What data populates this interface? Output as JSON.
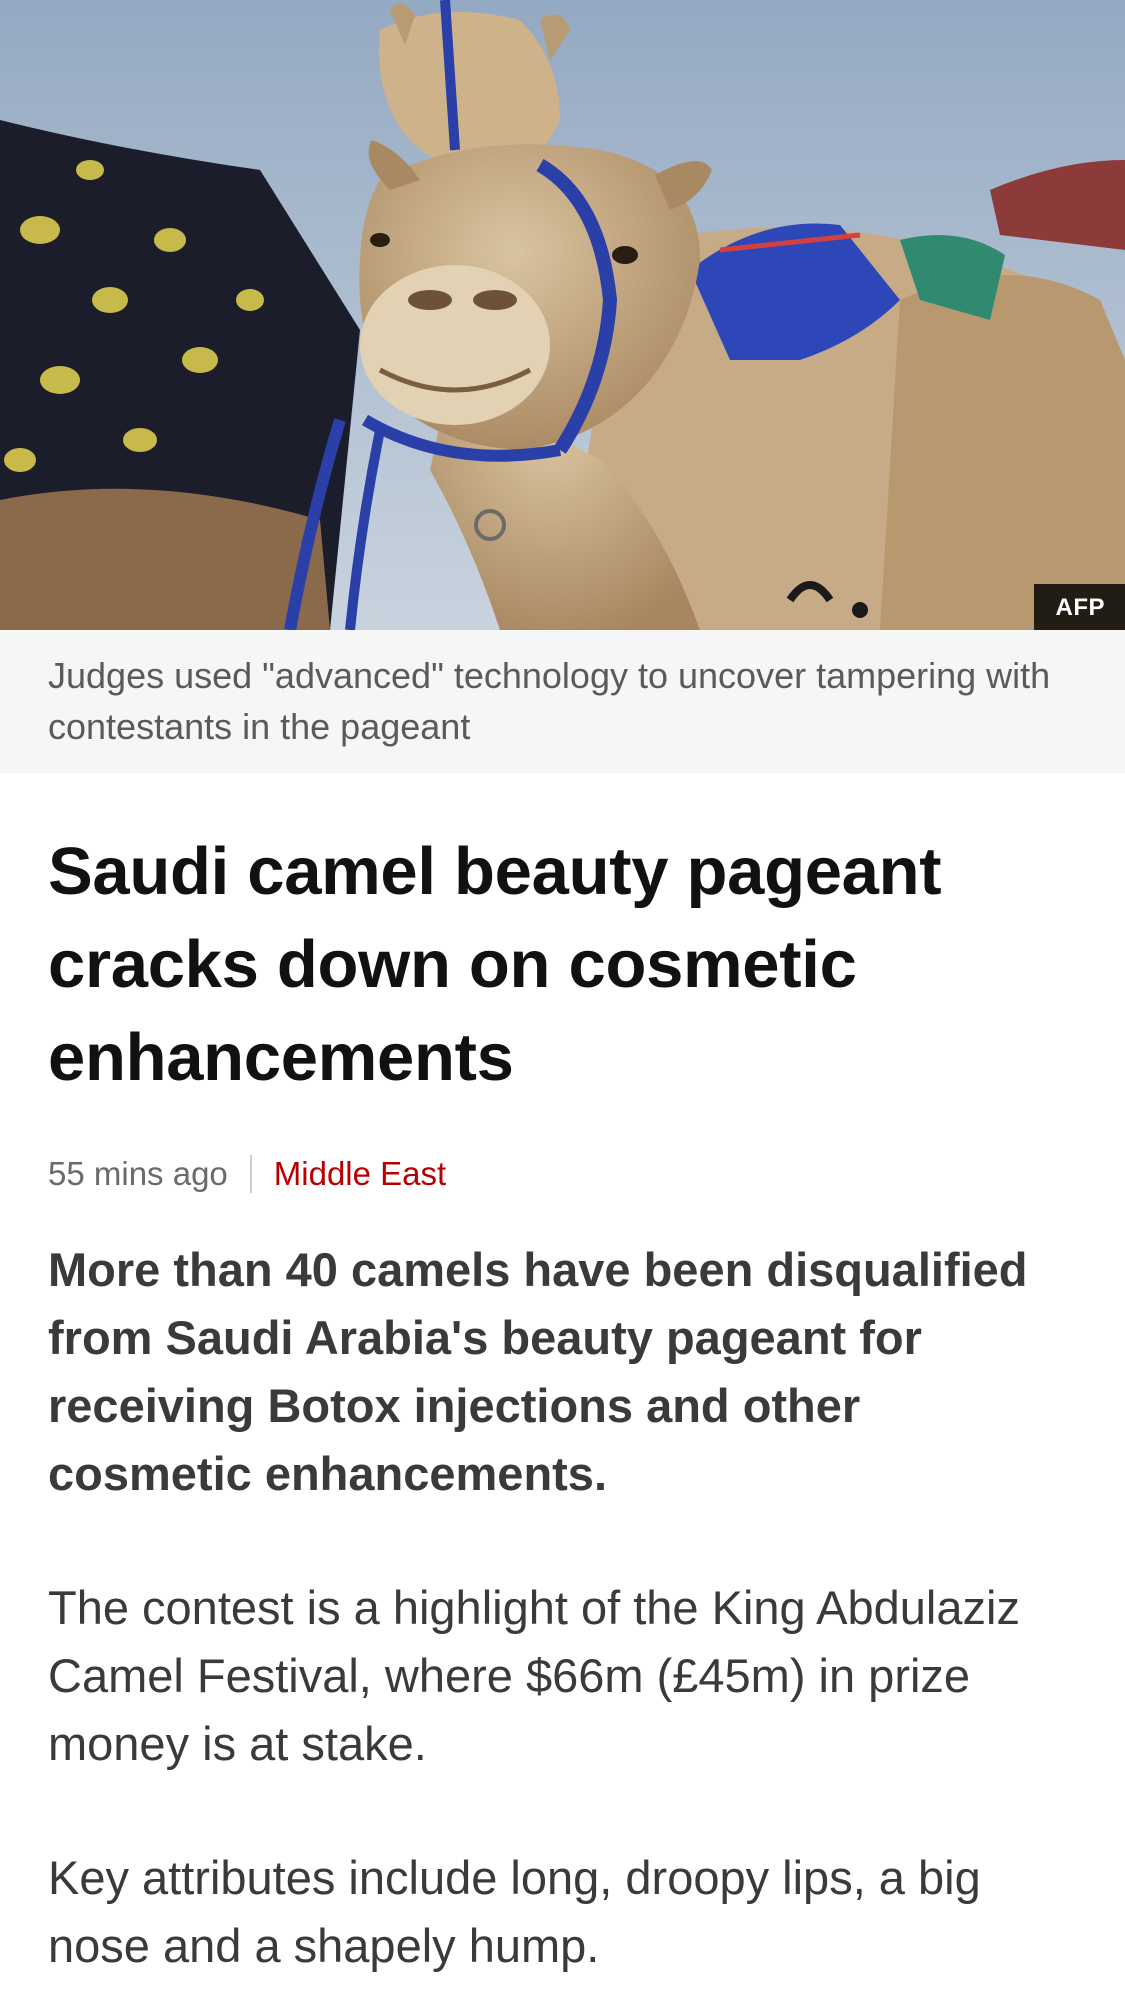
{
  "hero": {
    "image_alt": "Camels wearing blue halters and colourful saddle cloths",
    "credit": "AFP"
  },
  "caption": "Judges used \"advanced\" technology to uncover tampering with contestants in the pageant",
  "headline": "Saudi camel beauty pageant cracks down on cosmetic enhancements",
  "meta": {
    "time": "55 mins ago",
    "section": "Middle East"
  },
  "body": {
    "intro": "More than 40 camels have been disqualified from Saudi Arabia's beauty pageant for receiving Botox injections and other cosmetic enhancements.",
    "paragraphs": [
      "The contest is a highlight of the King Abdulaziz Camel Festival, where $66m (£45m) in prize money is at stake.",
      "Key attributes include long, droopy lips, a big nose and a shapely hump."
    ]
  },
  "colors": {
    "section_link": "#b80000",
    "caption_bg": "#f6f6f6",
    "headline": "#111111"
  }
}
